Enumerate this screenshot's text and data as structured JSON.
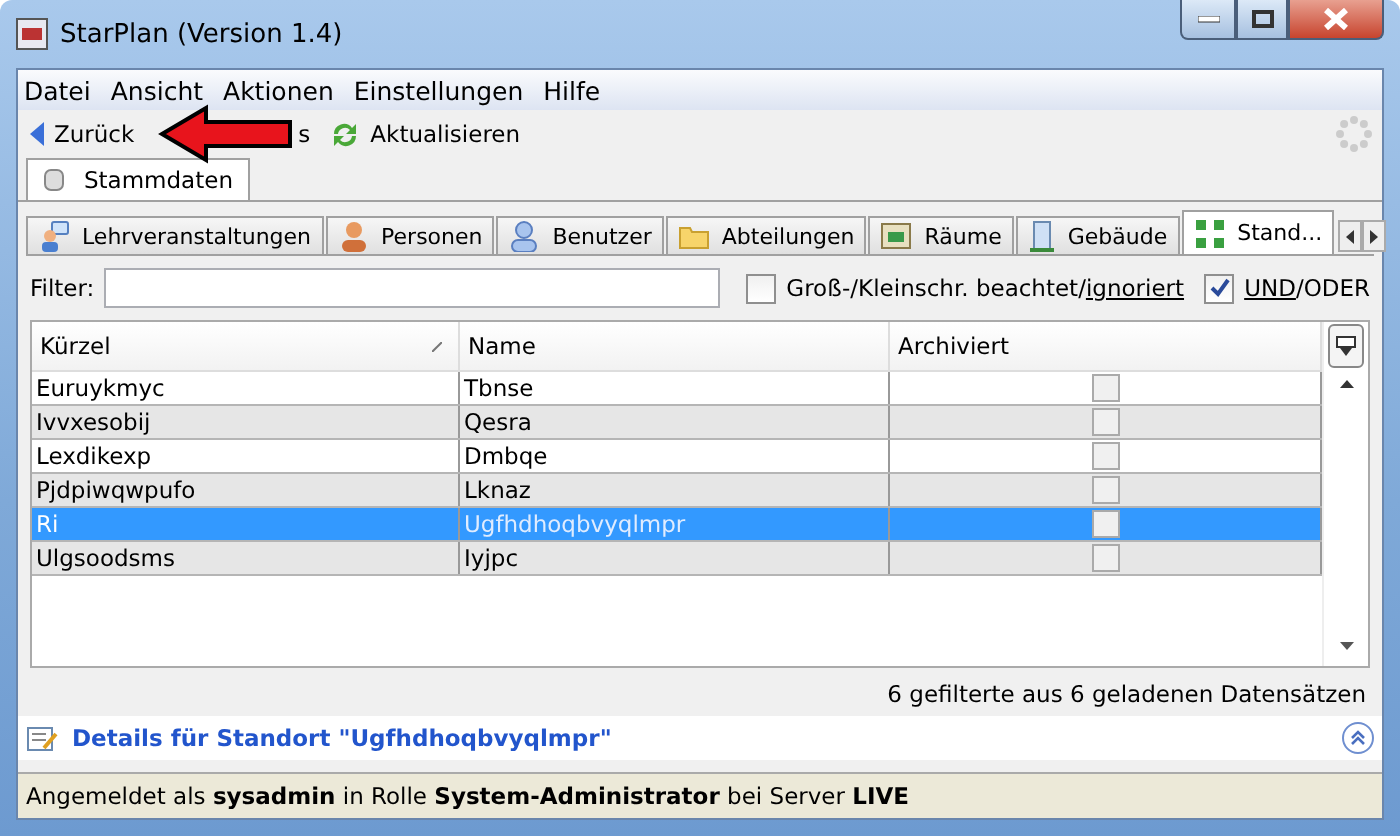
{
  "window": {
    "title": "StarPlan (Version 1.4)"
  },
  "menu": [
    "Datei",
    "Ansicht",
    "Aktionen",
    "Einstellungen",
    "Hilfe"
  ],
  "toolbar": [
    {
      "kind": "back",
      "label": "Zurück"
    },
    {
      "kind": "forward",
      "label": "s"
    },
    {
      "kind": "refresh",
      "label": "Aktualisieren"
    }
  ],
  "main_tabs": [
    {
      "label": "Stammdaten",
      "selected": true
    }
  ],
  "sub_tabs": [
    {
      "label": "Lehrveranstaltungen",
      "selected": false
    },
    {
      "label": "Personen",
      "selected": false
    },
    {
      "label": "Benutzer",
      "selected": false
    },
    {
      "label": "Abteilungen",
      "selected": false
    },
    {
      "label": "Räume",
      "selected": false
    },
    {
      "label": "Gebäude",
      "selected": false
    },
    {
      "label": "Stand...",
      "selected": true
    }
  ],
  "filter": {
    "label": "Filter:"
  },
  "case_option": {
    "label": "Groß-/Kleinschr. beachtet/",
    "link": "ignoriert",
    "checked": false
  },
  "logic_option": {
    "link": "UND",
    "label": "/ODER",
    "checked": true
  },
  "table": {
    "columns": [
      "Kürzel",
      "Name",
      "Archiviert"
    ],
    "rows": [
      {
        "kuerzel": "Euruykmyc",
        "name": "Tbnse",
        "archived": false,
        "selected": false
      },
      {
        "kuerzel": "Ivvxesobij",
        "name": "Qesra",
        "archived": false,
        "selected": false
      },
      {
        "kuerzel": "Lexdikexp",
        "name": "Dmbqe",
        "archived": false,
        "selected": false
      },
      {
        "kuerzel": "Pjdpiwqwpufo",
        "name": "Lknaz",
        "archived": false,
        "selected": false
      },
      {
        "kuerzel": "Ri",
        "name": "Ugfhdhoqbvyqlmpr",
        "archived": false,
        "selected": true
      },
      {
        "kuerzel": "Ulgsoodsms",
        "name": "Iyjpc",
        "archived": false,
        "selected": false
      }
    ]
  },
  "record_count": "6 gefilterte aus 6 geladenen Datensätzen",
  "details": {
    "title": "Details für Standort \"Ugfhdhoqbvyqlmpr\"",
    "expanded": true
  },
  "status_bar": "Angemeldet als **sysadmin** in Rolle **System-Administrator** bei Server **LIVE**"
}
